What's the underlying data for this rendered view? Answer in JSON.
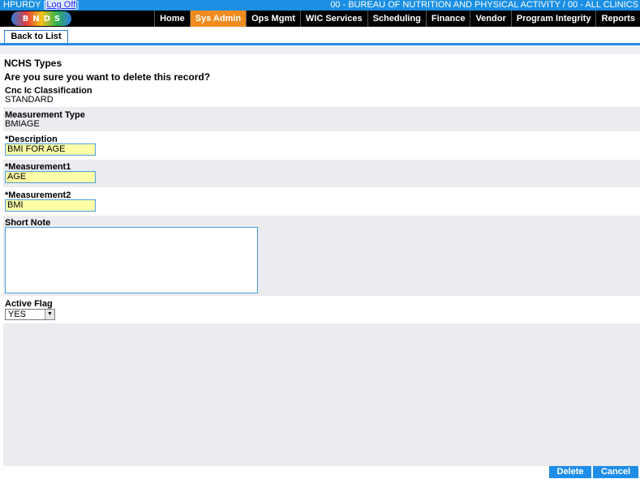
{
  "topbar": {
    "user": "HPURDY",
    "logoff": "Log Off",
    "org": "00 - BUREAU OF NUTRITION AND PHYSICAL ACTIVITY / 00 - ALL CLINICS"
  },
  "logo": {
    "letters": [
      "B",
      "N",
      "D",
      "S"
    ]
  },
  "nav": [
    {
      "label": "Home"
    },
    {
      "label": "Sys Admin"
    },
    {
      "label": "Ops Mgmt"
    },
    {
      "label": "WIC Services"
    },
    {
      "label": "Scheduling"
    },
    {
      "label": "Finance"
    },
    {
      "label": "Vendor"
    },
    {
      "label": "Program Integrity"
    },
    {
      "label": "Reports"
    }
  ],
  "colors": {
    "active_nav": "#f08b1d",
    "accent": "#1f8ee8",
    "required_field": "#ffffa8"
  },
  "toolbar": {
    "back_label": "Back to List"
  },
  "page": {
    "title": "NCHS Types",
    "confirm": "Are you sure you want to delete this record?"
  },
  "fields": {
    "classification": {
      "label": "Cnc Ic Classification",
      "value": "STANDARD"
    },
    "measurement_type": {
      "label": "Measurement Type",
      "value": "BMIAGE"
    },
    "description": {
      "label": "*Description",
      "value": "BMI FOR AGE"
    },
    "measurement1": {
      "label": "*Measurement1",
      "value": "AGE"
    },
    "measurement2": {
      "label": "*Measurement2",
      "value": "BMI"
    },
    "short_note": {
      "label": "Short Note",
      "value": ""
    },
    "active_flag": {
      "label": "Active Flag",
      "value": "YES"
    }
  },
  "footer": {
    "delete_label": "Delete",
    "cancel_label": "Cancel"
  }
}
